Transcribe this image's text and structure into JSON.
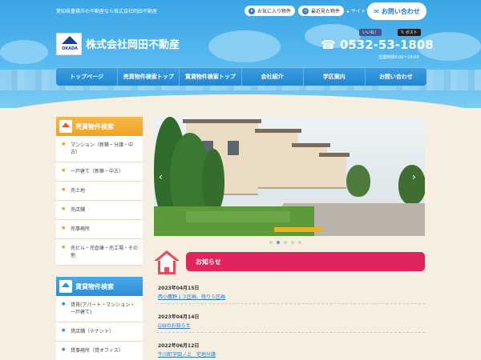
{
  "header": {
    "tagline": "愛知県豊橋市の不動産なら株式会社岡田不動産",
    "links": [
      {
        "label": "お気に入り物件",
        "icon": "star-icon"
      },
      {
        "label": "最近見た物件",
        "icon": "clock-icon"
      }
    ],
    "sitemap": "▸ サイトマップ",
    "contact_button": "お問い合わせ",
    "logo_text": "OKADA",
    "company_name": "株式会社岡田不動産",
    "facebook": "いいね！",
    "twitter": "ポスト",
    "phone": "0532-53-1808",
    "hours": "営業時間9:00～19:00"
  },
  "nav": [
    "トップページ",
    "売買物件検索トップ",
    "賃貸物件検索トップ",
    "会社紹介",
    "学区案内",
    "お問い合わせ"
  ],
  "sidebar": {
    "sale_title": "売買物件検索",
    "sale_items": [
      "マンション（新築・分譲・中古）",
      "一戸建て（新築・中古）",
      "売土地",
      "売店舗",
      "売事務所",
      "売ビル・売倉庫・売工場・その他"
    ],
    "rent_title": "賃貸物件検索",
    "rent_items": [
      "貸賃(アパート・マンション・一戸建て)",
      "貸店舗（テナント）",
      "貸事務所（貸オフィス）"
    ]
  },
  "slider": {
    "prev": "‹",
    "next": "›",
    "dot_count": 5,
    "active_dot": 1
  },
  "news": {
    "title": "お知らせ",
    "items": [
      {
        "date": "2023年04月15日",
        "title": "西小鷹野１３区画、残り５区画"
      },
      {
        "date": "2023年04月14日",
        "title": "GWのお知らせ"
      },
      {
        "date": "2022年06月12日",
        "title": "牛川町字田ノ上　宅地分譲"
      }
    ]
  }
}
